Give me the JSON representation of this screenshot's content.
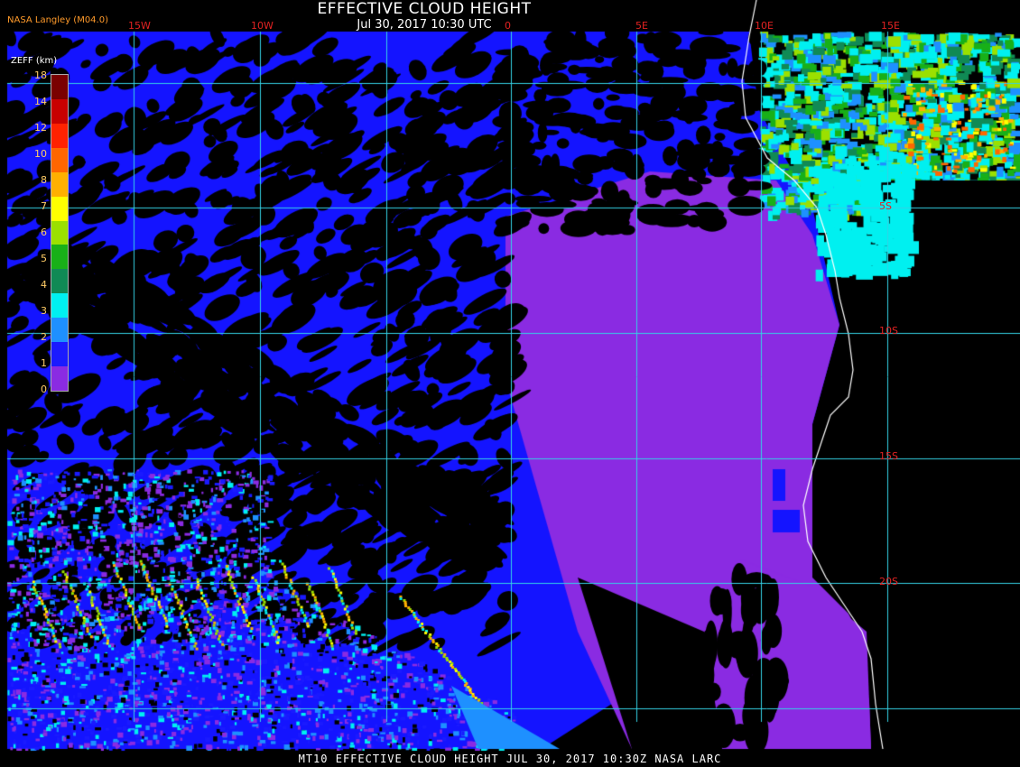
{
  "header": {
    "title": "EFFECTIVE CLOUD HEIGHT",
    "subtitle": "Jul 30, 2017 10:30 UTC",
    "credit": "NASA Langley (M04.0)"
  },
  "footer": {
    "text": "MT10  EFFECTIVE CLOUD HEIGHT  JUL 30, 2017 10:30Z  NASA LARC"
  },
  "map": {
    "longitude_labels": [
      "15W",
      "10W",
      "0",
      "5E",
      "10E",
      "15E"
    ],
    "latitude_labels": [
      "5S",
      "10S",
      "15S",
      "20S"
    ],
    "colors": {
      "grid": "#34d2e6",
      "coast": "#ffffff",
      "label": "#e32222",
      "ocean_black": "#000000",
      "low_cloud_purple": "#8a2be2",
      "mid_blue": "#1414ff",
      "land_green": "#2aa84a"
    }
  },
  "legend": {
    "units_label": "ZEFF (km)",
    "ticks": [
      "18",
      "14",
      "12",
      "10",
      "8",
      "7",
      "6",
      "5",
      "4",
      "3",
      "2",
      "1",
      "0"
    ],
    "colors": [
      "#7a0000",
      "#c80000",
      "#ff2200",
      "#ff6600",
      "#ffb000",
      "#ffff00",
      "#9be000",
      "#18b018",
      "#108a55",
      "#00f0f0",
      "#1e90ff",
      "#1a1aff",
      "#8a2be2"
    ]
  }
}
